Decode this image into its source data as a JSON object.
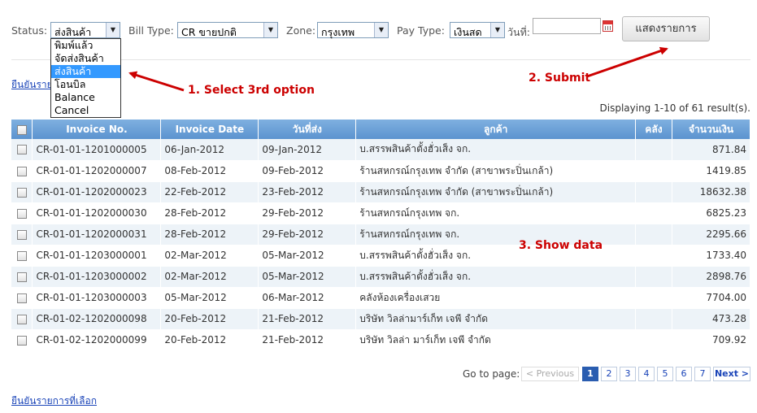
{
  "filters": {
    "status_label": "Status:",
    "status_value": "ส่งสินค้า",
    "bill_type_label": "Bill Type:",
    "bill_type_value": "CR ขายปกติ",
    "zone_label": "Zone:",
    "zone_value": "กรุงเทพ",
    "pay_type_label": "Pay Type:",
    "pay_type_value": "เงินสด",
    "date_label": "วันที่:",
    "date_value": "",
    "submit_label": "แสดงรายการ"
  },
  "status_options": [
    "พิมพ์แล้ว",
    "จัดส่งสินค้า",
    "ส่งสินค้า",
    "โอนบิล",
    "Balance",
    "Cancel"
  ],
  "annotations": {
    "step1": "1. Select 3rd option",
    "step2": "2. Submit",
    "step3": "3. Show data",
    "color": "#cc0000"
  },
  "confirm_link": "ยืนยันรายการที่เลือก",
  "confirm_link_top_visible": "ยืนยันราย",
  "displaying": "Displaying 1-10 of 61 result(s).",
  "table": {
    "columns": [
      "Invoice No.",
      "Invoice Date",
      "วันที่ส่ง",
      "ลูกค้า",
      "คลัง",
      "จำนวนเงิน"
    ],
    "rows": [
      [
        "CR-01-01-1201000005",
        "06-Jan-2012",
        "09-Jan-2012",
        "บ.สรรพสินค้าตั้งฮั่วเส็ง จก.",
        "",
        "871.84"
      ],
      [
        "CR-01-01-1202000007",
        "08-Feb-2012",
        "09-Feb-2012",
        "ร้านสหกรณ์กรุงเทพ จำกัด (สาขาพระปิ่นเกล้า)",
        "",
        "1419.85"
      ],
      [
        "CR-01-01-1202000023",
        "22-Feb-2012",
        "23-Feb-2012",
        "ร้านสหกรณ์กรุงเทพ จำกัด (สาขาพระปิ่นเกล้า)",
        "",
        "18632.38"
      ],
      [
        "CR-01-01-1202000030",
        "28-Feb-2012",
        "29-Feb-2012",
        "ร้านสหกรณ์กรุงเทพ จก.",
        "",
        "6825.23"
      ],
      [
        "CR-01-01-1202000031",
        "28-Feb-2012",
        "29-Feb-2012",
        "ร้านสหกรณ์กรุงเทพ จก.",
        "",
        "2295.66"
      ],
      [
        "CR-01-01-1203000001",
        "02-Mar-2012",
        "05-Mar-2012",
        "บ.สรรพสินค้าตั้งฮั่วเส็ง จก.",
        "",
        "1733.40"
      ],
      [
        "CR-01-01-1203000002",
        "02-Mar-2012",
        "05-Mar-2012",
        "บ.สรรพสินค้าตั้งฮั่วเส็ง จก.",
        "",
        "2898.76"
      ],
      [
        "CR-01-01-1203000003",
        "05-Mar-2012",
        "06-Mar-2012",
        "คลังห้องเครื่องเสวย",
        "",
        "7704.00"
      ],
      [
        "CR-01-02-1202000098",
        "20-Feb-2012",
        "21-Feb-2012",
        "บริษัท วิลล่ามาร์เก็ท เจพี จำกัด",
        "",
        "473.28"
      ],
      [
        "CR-01-02-1202000099",
        "20-Feb-2012",
        "21-Feb-2012",
        "บริษัท วิลล่า มาร์เก็ท เจพี จำกัด",
        "",
        "709.92"
      ]
    ]
  },
  "pager": {
    "goto_label": "Go to page:",
    "previous": "< Previous",
    "pages": [
      "1",
      "2",
      "3",
      "4",
      "5",
      "6",
      "7"
    ],
    "current": "1",
    "next": "Next >"
  },
  "icons": {
    "calendar": "calendar-icon",
    "checkbox": "checkbox-icon",
    "dropdown_arrow": "chevron-down-icon"
  },
  "colors": {
    "header_blue": "#5b93cf",
    "selected_option": "#3399ff",
    "link": "#1a44b8",
    "row_alt": "#edf3f8"
  }
}
